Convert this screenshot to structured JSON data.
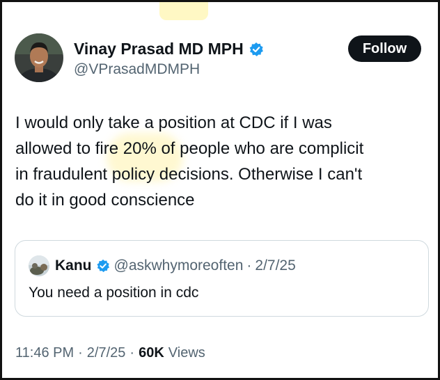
{
  "author": {
    "name": "Vinay Prasad MD MPH",
    "handle": "@VPrasadMDMPH",
    "verified_icon": "verified-badge-icon"
  },
  "follow_button": {
    "label": "Follow"
  },
  "tweet": {
    "lines": [
      "I would only take a position at CDC if I was",
      "allowed to fire 20% of people who are complicit",
      "in fraudulent policy decisions. Otherwise I can't",
      "do it in good conscience"
    ]
  },
  "quoted_tweet": {
    "name": "Kanu",
    "handle": "@askwhymoreoften",
    "separator": "·",
    "date": "2/7/25",
    "text": "You need a position in cdc"
  },
  "meta": {
    "time": "11:46 PM",
    "separator": "·",
    "date": "2/7/25",
    "views_count": "60K",
    "views_label": "Views"
  },
  "colors": {
    "text_primary": "#0f1419",
    "text_secondary": "#536471",
    "verified_blue": "#1d9bf0",
    "follow_bg": "#0f1419",
    "border": "#cfd9de"
  }
}
